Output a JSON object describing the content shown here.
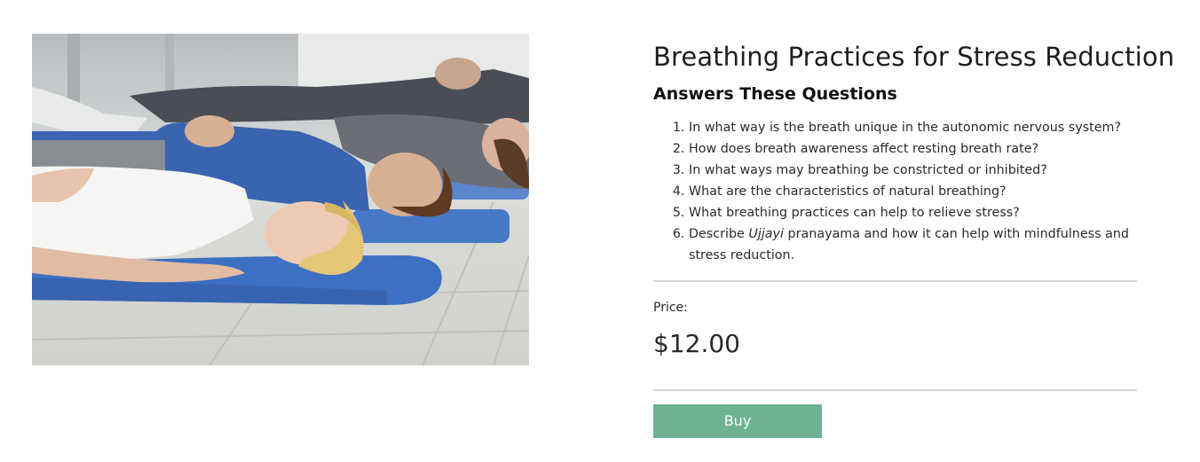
{
  "product": {
    "title": "Breathing Practices for Stress Reduction",
    "subheading": "Answers These Questions",
    "questions": [
      "In what way is the breath unique in the autonomic nervous system?",
      "How does breath awareness affect resting breath rate?",
      "In what ways may breathing be constricted or inhibited?",
      "What are the characteristics of natural breathing?",
      "What breathing practices can help to relieve stress?"
    ],
    "question_6": {
      "before": "Describe ",
      "emphasis": "Ujjayi",
      "after": " pranayama and how it can help with mindfulness and stress reduction."
    },
    "price_label": "Price:",
    "price_value": "$12.00",
    "buy_label": "Buy",
    "image_subject": "people-lying-on-yoga-mats-photo"
  },
  "colors": {
    "buy_button": "#6db393",
    "divider": "#d5d5d5",
    "mat_blue": "#3c6fc0"
  }
}
